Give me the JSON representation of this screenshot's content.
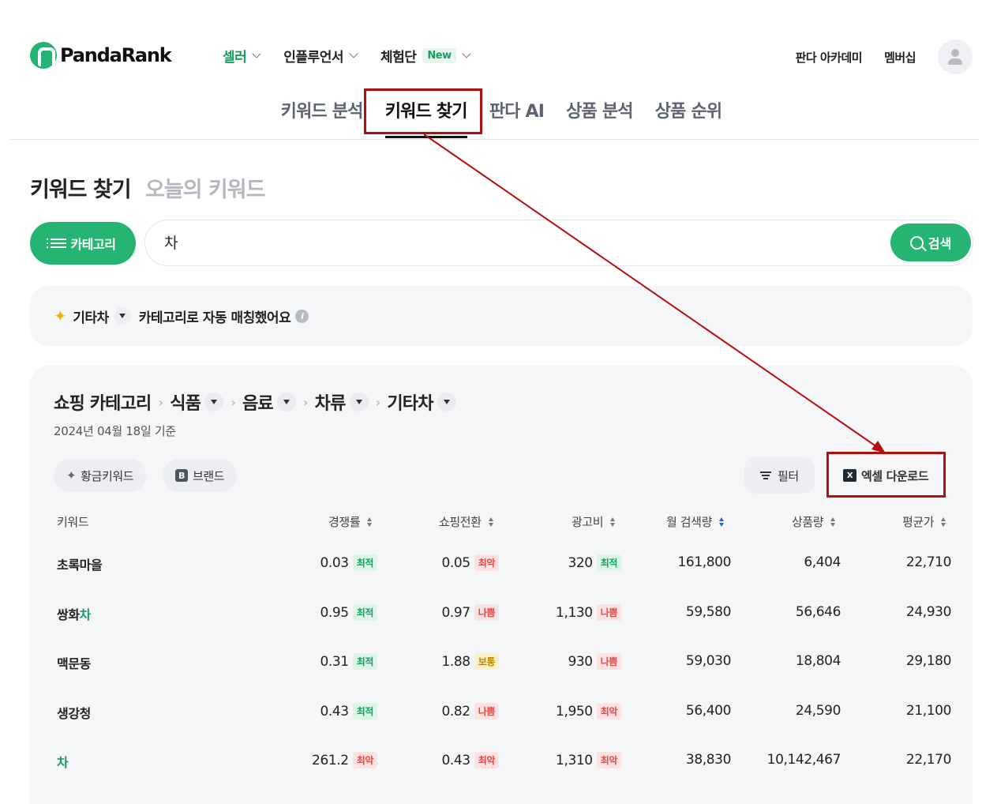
{
  "header": {
    "logo": "PandaRank",
    "nav": [
      {
        "label": "셀러",
        "active": true
      },
      {
        "label": "인플루언서"
      },
      {
        "label": "체험단",
        "badge": "New"
      }
    ],
    "right_links": [
      "판다 아카데미",
      "멤버십"
    ]
  },
  "subnav": {
    "tabs": [
      "키워드 분석",
      "키워드 찾기",
      "판다 AI",
      "상품 분석",
      "상품 순위"
    ],
    "active": "키워드 찾기"
  },
  "page": {
    "title": "키워드 찾기",
    "alt_title": "오늘의 키워드"
  },
  "search": {
    "category_button": "카테고리",
    "query": "차",
    "button": "검색"
  },
  "auto_match": {
    "category": "기타차",
    "message": "카테고리로 자동 매칭했어요",
    "info": "i"
  },
  "results": {
    "breadcrumb_root": "쇼핑 카테고리",
    "breadcrumb": [
      "식품",
      "음료",
      "차류",
      "기타차"
    ],
    "date": "2024년 04월 18일 기준",
    "chips": [
      "황금키워드",
      "브랜드"
    ],
    "filter_button": "필터",
    "excel_button": "엑셀 다운로드",
    "columns": [
      "키워드",
      "경쟁률",
      "쇼핑전환",
      "광고비",
      "월 검색량",
      "상품량",
      "평균가"
    ],
    "rows": [
      {
        "kw_pre": "초록마을",
        "kw_hl": "",
        "comp": "0.03",
        "comp_b": "최적",
        "conv": "0.05",
        "conv_b": "최악",
        "ad": "320",
        "ad_b": "최적",
        "vol": "161,800",
        "prod": "6,404",
        "price": "22,710"
      },
      {
        "kw_pre": "쌍화",
        "kw_hl": "차",
        "comp": "0.95",
        "comp_b": "최적",
        "conv": "0.97",
        "conv_b": "나쁨",
        "ad": "1,130",
        "ad_b": "나쁨",
        "vol": "59,580",
        "prod": "56,646",
        "price": "24,930"
      },
      {
        "kw_pre": "맥문동",
        "kw_hl": "",
        "comp": "0.31",
        "comp_b": "최적",
        "conv": "1.88",
        "conv_b": "보통",
        "ad": "930",
        "ad_b": "나쁨",
        "vol": "59,030",
        "prod": "18,804",
        "price": "29,180"
      },
      {
        "kw_pre": "생강청",
        "kw_hl": "",
        "comp": "0.43",
        "comp_b": "최적",
        "conv": "0.82",
        "conv_b": "나쁨",
        "ad": "1,950",
        "ad_b": "최악",
        "vol": "56,400",
        "prod": "24,590",
        "price": "21,100"
      },
      {
        "kw_pre": "",
        "kw_hl": "차",
        "comp": "261.2",
        "comp_b": "최악",
        "conv": "0.43",
        "conv_b": "최악",
        "ad": "1,310",
        "ad_b": "최악",
        "vol": "38,830",
        "prod": "10,142,467",
        "price": "22,170"
      }
    ]
  },
  "colors": {
    "brand_green": "#26b472",
    "annotation_red": "#b40f0f",
    "good": "#1a9d62",
    "bad": "#e24a4a",
    "mid": "#b8860b"
  }
}
